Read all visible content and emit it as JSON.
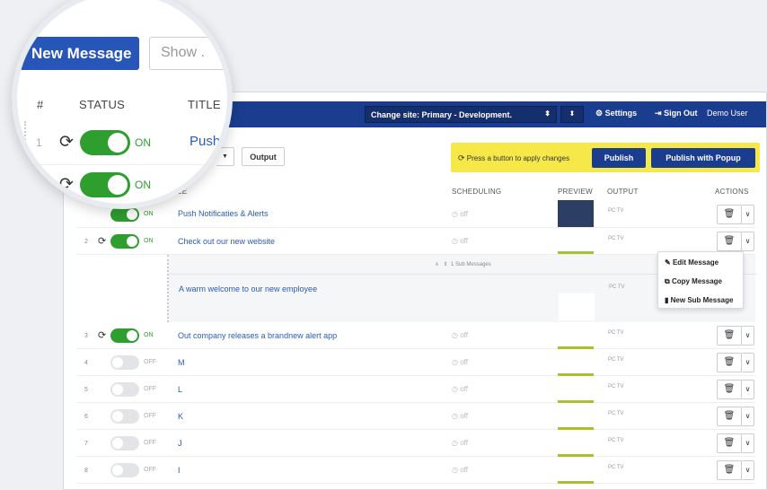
{
  "header": {
    "site_select": "Change site: Primary - Development.",
    "settings": "Settings",
    "signout": "Sign Out",
    "user": "Demo User"
  },
  "toolbar": {
    "new_message": "New Message",
    "show": "Show .",
    "output": "Output"
  },
  "notice": {
    "text": "Press a button to apply changes",
    "publish": "Publish",
    "publish_popup": "Publish with Popup"
  },
  "columns": {
    "num": "#",
    "status": "STATUS",
    "title": "TITLE",
    "title_partial": "LE",
    "scheduling": "SCHEDULING",
    "preview": "PREVIEW",
    "output": "OUTPUT",
    "actions": "ACTIONS"
  },
  "rows": [
    {
      "num": "1",
      "status": "ON",
      "title": "Push Notificaties & Alerts",
      "sched": "off",
      "output": "PC TV"
    },
    {
      "num": "2",
      "status": "ON",
      "title": "Check out our new website",
      "sched": "off",
      "output": "PC TV"
    },
    {
      "num": "3",
      "status": "ON",
      "title": "Out company releases a brandnew alert app",
      "sched": "off",
      "output": "PC TV"
    },
    {
      "num": "4",
      "status": "OFF",
      "title": "M",
      "sched": "off",
      "output": "PC TV"
    },
    {
      "num": "5",
      "status": "OFF",
      "title": "L",
      "sched": "off",
      "output": "PC TV"
    },
    {
      "num": "6",
      "status": "OFF",
      "title": "K",
      "sched": "off",
      "output": "PC TV"
    },
    {
      "num": "7",
      "status": "OFF",
      "title": "J",
      "sched": "off",
      "output": "PC TV"
    },
    {
      "num": "8",
      "status": "OFF",
      "title": "I",
      "sched": "off",
      "output": "PC TV"
    }
  ],
  "sub_messages": {
    "label": "1 Sub Messages",
    "item_title": "A warm welcome to our new employee",
    "item_output": "PC TV"
  },
  "context_menu": {
    "edit": "Edit Message",
    "copy": "Copy Message",
    "new_sub": "New Sub Message"
  },
  "magnifier": {
    "row1_num": "1",
    "row1_status": "ON",
    "row1_title": "Push",
    "row2_status": "ON"
  },
  "colors": {
    "navy": "#1a3d8f",
    "green": "#2e9e2e",
    "notice": "#f7e84a",
    "preview_bar": "#a8c22a"
  }
}
